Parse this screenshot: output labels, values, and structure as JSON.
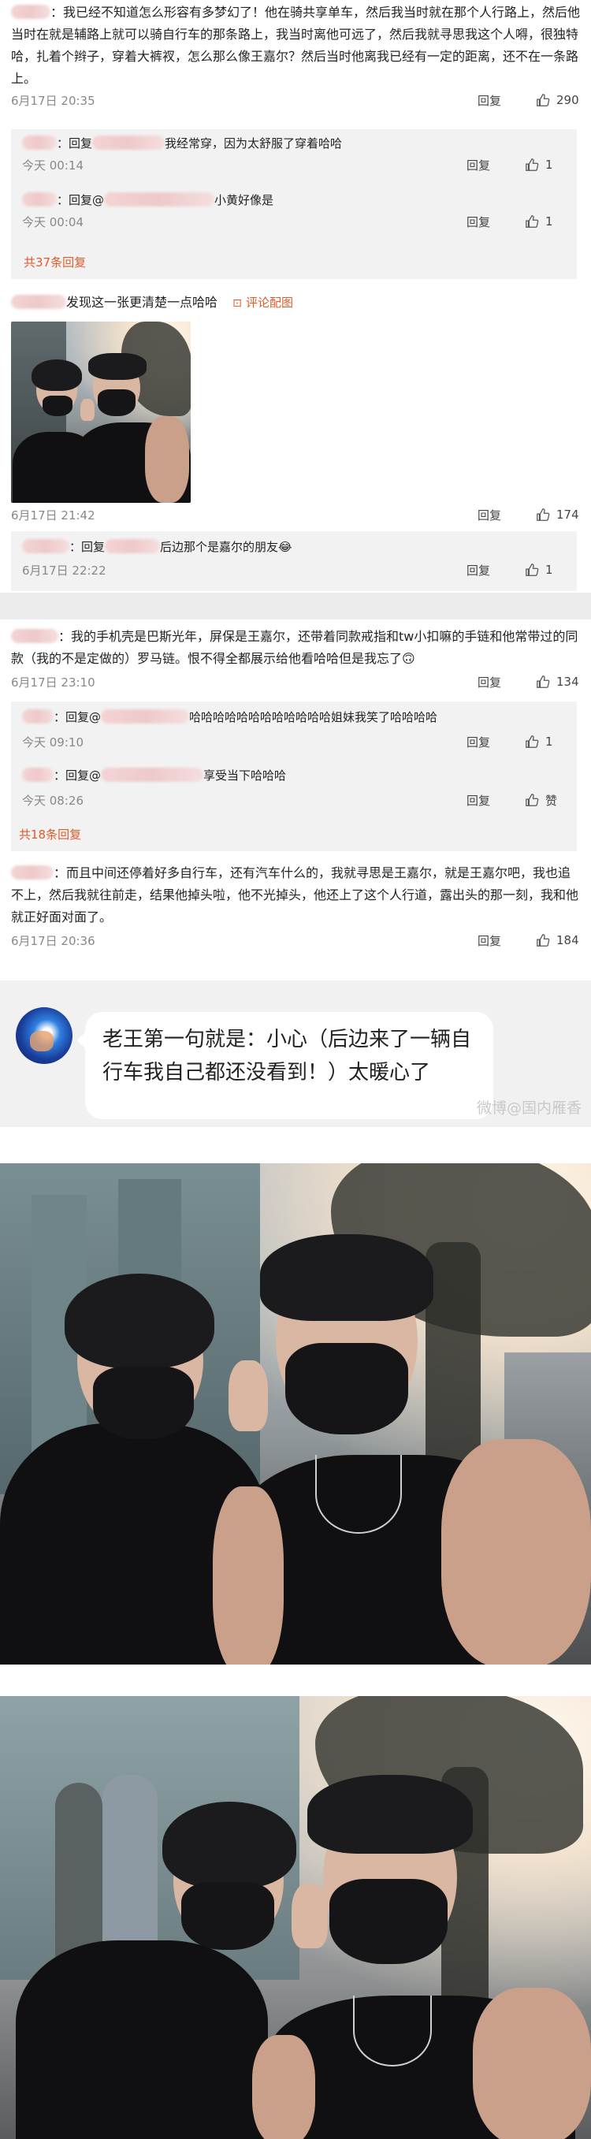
{
  "comments": [
    {
      "text": "：我已经不知道怎么形容有多梦幻了！他在骑共享单车，然后我当时就在那个人行路上，然后他当时在就是辅路上就可以骑自行车的那条路上，我当时离他可远了，然后我就寻思我这个人嘚，很独特哈，扎着个辫子，穿着大裤衩，怎么那么像王嘉尔？然后当时他离我已经有一定的距离，还不在一条路上。",
      "time": "6月17日 20:35",
      "reply": "回复",
      "likes": "290",
      "subs": [
        {
          "prefix": "：回复",
          "text": "我经常穿，因为太舒服了穿着哈哈",
          "time": "今天 00:14",
          "reply": "回复",
          "likes": "1"
        },
        {
          "prefix": "：回复@",
          "text": "小黄好像是",
          "time": "今天 00:04",
          "reply": "回复",
          "likes": "1"
        }
      ],
      "more": "共37条回复"
    },
    {
      "text": "发现这一张更清楚一点哈哈",
      "pic_link": "评论配图",
      "time": "6月17日 21:42",
      "reply": "回复",
      "likes": "174",
      "subs": [
        {
          "prefix": "：回复",
          "text": "后边那个是嘉尔的朋友😂",
          "time": "6月17日 22:22",
          "reply": "回复",
          "likes": "1"
        }
      ]
    },
    {
      "text": "：我的手机壳是巴斯光年，屏保是王嘉尔，还带着同款戒指和tw小扣嘛的手链和他常带过的同款（我的不是定做的）罗马链。恨不得全都展示给他看哈哈但是我忘了🙃",
      "time": "6月17日 23:10",
      "reply": "回复",
      "likes": "134",
      "subs": [
        {
          "prefix": "：回复@",
          "text": "哈哈哈哈哈哈哈哈哈哈哈哈姐妹我笑了哈哈哈哈",
          "time": "今天 09:10",
          "reply": "回复",
          "likes": "1"
        },
        {
          "prefix": "：回复@",
          "text": "享受当下哈哈哈",
          "time": "今天 08:26",
          "reply": "回复",
          "likes": "赞"
        }
      ],
      "more": "共18条回复"
    },
    {
      "text": "：而且中间还停着好多自行车，还有汽车什么的，我就寻思是王嘉尔，就是王嘉尔吧，我也追不上，然后我就往前走，结果他掉头啦，他不光掉头，他还上了这个人行道，露出头的那一刻，我和他就正好面对面了。",
      "time": "6月17日 20:36",
      "reply": "回复",
      "likes": "184"
    }
  ],
  "bubble": {
    "text": "老王第一句就是：小心（后边来了一辆自行车我自己都还没看到！）太暖心了",
    "watermark": "微博@国内雁香"
  },
  "colors": {
    "accent": "#e05a2b",
    "panel": "#f2f2f2",
    "separator": "#ececec"
  }
}
